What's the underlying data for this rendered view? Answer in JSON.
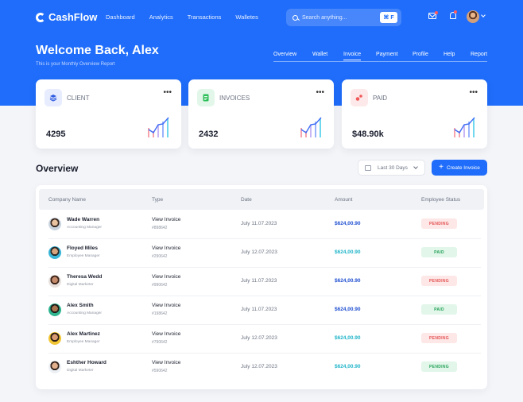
{
  "app": {
    "name": "CashFlow"
  },
  "nav": {
    "items": [
      "Dashboard",
      "Analytics",
      "Transactions",
      "Walletes"
    ]
  },
  "search": {
    "placeholder": "Search anything...",
    "shortcut": "⌘ F"
  },
  "hero": {
    "title": "Welcome Back, Alex",
    "subtitle": "This is your Monthly Overview Report"
  },
  "subnav": {
    "items": [
      "Overview",
      "Wallet",
      "Invoice",
      "Payment",
      "Profile",
      "Help",
      "Report"
    ],
    "active": "Invoice"
  },
  "cards": [
    {
      "label": "CLIENT",
      "value": "4295",
      "icon": "stack-icon",
      "icon_color": "#2f5be0",
      "icon_bg": "#e7edff"
    },
    {
      "label": "INVOICES",
      "value": "2432",
      "icon": "document-icon",
      "icon_color": "#2fbf5a",
      "icon_bg": "#e2f7e9"
    },
    {
      "label": "PAID",
      "value": "$48.90k",
      "icon": "paid-icon",
      "icon_color": "#f05a5a",
      "icon_bg": "#fde9e9"
    }
  ],
  "overview": {
    "title": "Overview",
    "range": "Last 30 Days",
    "create_label": "Create Invoice",
    "columns": [
      "Company Name",
      "Type",
      "Date",
      "Amount",
      "Employee Status"
    ],
    "rows": [
      {
        "name": "Wade Warren",
        "role": "Accounting Manager",
        "type": "View Invoice",
        "number": "#898642",
        "date": "July 11.07.2023",
        "amount": "$624,00.90",
        "amount_color": "#1f4fd1",
        "status": "PENDING",
        "status_color": "#e55353",
        "status_bg": "#fde7e7"
      },
      {
        "name": "Floyed Miles",
        "role": "Employee Manager",
        "type": "View Invoice",
        "number": "#290642",
        "date": "July 12.07.2023",
        "amount": "$624,00.90",
        "amount_color": "#1fb4c8",
        "status": "PAID",
        "status_color": "#27a35a",
        "status_bg": "#e2f6ea"
      },
      {
        "name": "Theresa Wedd",
        "role": "Digital Marketer",
        "type": "View Invoice",
        "number": "#990642",
        "date": "July 11.07.2023",
        "amount": "$624,00.90",
        "amount_color": "#1f4fd1",
        "status": "PENDING",
        "status_color": "#e55353",
        "status_bg": "#fde7e7"
      },
      {
        "name": "Alex Smith",
        "role": "Accounting Manager",
        "type": "View Invoice",
        "number": "#198642",
        "date": "July 11.07.2023",
        "amount": "$624,00.90",
        "amount_color": "#1f4fd1",
        "status": "PAID",
        "status_color": "#27a35a",
        "status_bg": "#e2f6ea"
      },
      {
        "name": "Alex Martinez",
        "role": "Employee Manager",
        "type": "View Invoice",
        "number": "#790642",
        "date": "July 12.07.2023",
        "amount": "$624,00.90",
        "amount_color": "#1fb4c8",
        "status": "PENDING",
        "status_color": "#e55353",
        "status_bg": "#fde7e7"
      },
      {
        "name": "Eshther Howard",
        "role": "Digital Marketer",
        "type": "View Invoice",
        "number": "#590642",
        "date": "July 12.07.2023",
        "amount": "$624,00.90",
        "amount_color": "#1fb4c8",
        "status": "PENDING",
        "status_color": "#27a35a",
        "status_bg": "#e2f6ea"
      }
    ]
  }
}
